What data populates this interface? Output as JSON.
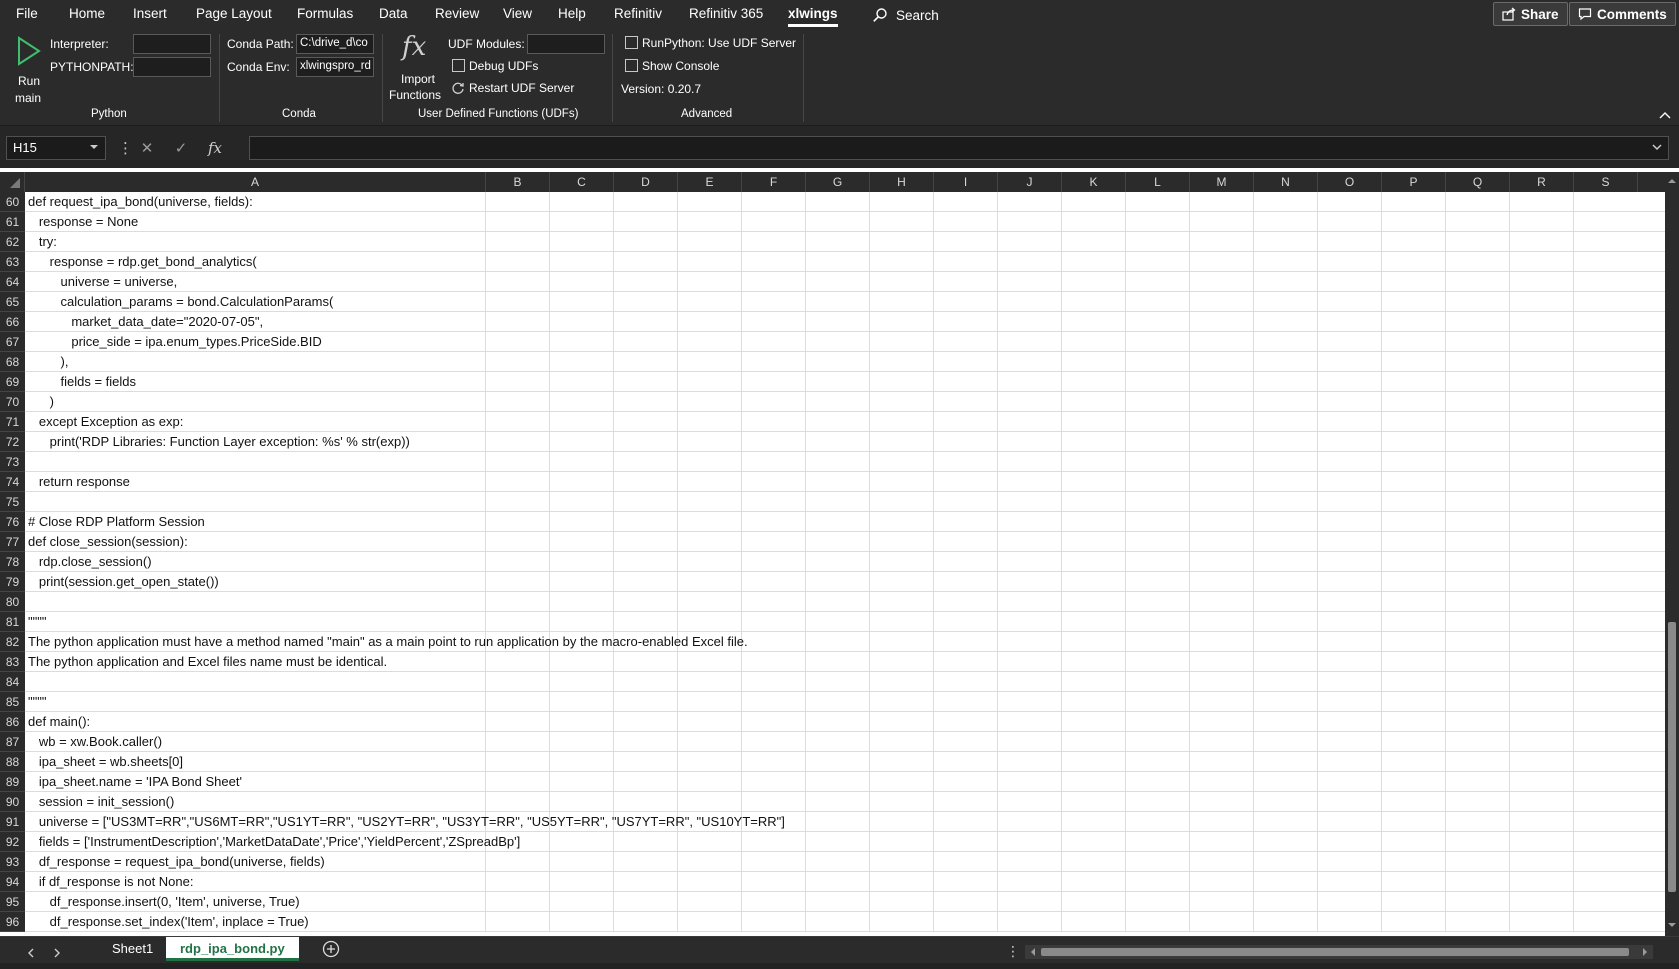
{
  "menu": {
    "tabs": [
      "File",
      "Home",
      "Insert",
      "Page Layout",
      "Formulas",
      "Data",
      "Review",
      "View",
      "Help",
      "Refinitiv",
      "Refinitiv 365",
      "xlwings"
    ],
    "active_tab": "xlwings",
    "search_label": "Search",
    "share_label": "Share",
    "comments_label": "Comments"
  },
  "ribbon": {
    "python": {
      "run_label_1": "Run",
      "run_label_2": "main",
      "interpreter_label": "Interpreter:",
      "interpreter_value": "",
      "pythonpath_label": "PYTHONPATH:",
      "pythonpath_value": "",
      "group_title": "Python"
    },
    "conda": {
      "path_label": "Conda Path:",
      "path_value": "C:\\drive_d\\co",
      "env_label": "Conda Env:",
      "env_value": "xlwingspro_rd",
      "group_title": "Conda"
    },
    "udf": {
      "fx_symbol": "fx",
      "import_label_1": "Import",
      "import_label_2": "Functions",
      "modules_label": "UDF Modules:",
      "modules_value": "",
      "debug_label": "Debug UDFs",
      "restart_label": "Restart UDF Server",
      "group_title": "User Defined Functions (UDFs)"
    },
    "advanced": {
      "runpython_label": "RunPython: Use UDF Server",
      "console_label": "Show Console",
      "version_label": "Version: 0.20.7",
      "group_title": "Advanced"
    }
  },
  "formula_bar": {
    "name_box": "H15",
    "fx_label": "fx",
    "cancel_glyph": "✕",
    "enter_glyph": "✓",
    "formula": ""
  },
  "columns": [
    "A",
    "B",
    "C",
    "D",
    "E",
    "F",
    "G",
    "H",
    "I",
    "J",
    "K",
    "L",
    "M",
    "N",
    "O",
    "P",
    "Q",
    "R",
    "S"
  ],
  "rows": [
    {
      "num": "60",
      "text": "def request_ipa_bond(universe, fields):"
    },
    {
      "num": "61",
      "text": "   response = None"
    },
    {
      "num": "62",
      "text": "   try:"
    },
    {
      "num": "63",
      "text": "      response = rdp.get_bond_analytics("
    },
    {
      "num": "64",
      "text": "         universe = universe,"
    },
    {
      "num": "65",
      "text": "         calculation_params = bond.CalculationParams("
    },
    {
      "num": "66",
      "text": "            market_data_date=\"2020-07-05\","
    },
    {
      "num": "67",
      "text": "            price_side = ipa.enum_types.PriceSide.BID"
    },
    {
      "num": "68",
      "text": "         ),"
    },
    {
      "num": "69",
      "text": "         fields = fields"
    },
    {
      "num": "70",
      "text": "      )"
    },
    {
      "num": "71",
      "text": "   except Exception as exp:"
    },
    {
      "num": "72",
      "text": "      print('RDP Libraries: Function Layer exception: %s' % str(exp))"
    },
    {
      "num": "73",
      "text": ""
    },
    {
      "num": "74",
      "text": "   return response"
    },
    {
      "num": "75",
      "text": ""
    },
    {
      "num": "76",
      "text": "# Close RDP Platform Session"
    },
    {
      "num": "77",
      "text": "def close_session(session):"
    },
    {
      "num": "78",
      "text": "   rdp.close_session()"
    },
    {
      "num": "79",
      "text": "   print(session.get_open_state())"
    },
    {
      "num": "80",
      "text": ""
    },
    {
      "num": "81",
      "text": "\"\"\"\""
    },
    {
      "num": "82",
      "text": "The python application must have a method named \"main\" as a main point to run application by the macro-enabled Excel file."
    },
    {
      "num": "83",
      "text": "The python application and Excel files name must be identical."
    },
    {
      "num": "84",
      "text": ""
    },
    {
      "num": "85",
      "text": "\"\"\"\""
    },
    {
      "num": "86",
      "text": "def main():"
    },
    {
      "num": "87",
      "text": "   wb = xw.Book.caller()"
    },
    {
      "num": "88",
      "text": "   ipa_sheet = wb.sheets[0]"
    },
    {
      "num": "89",
      "text": "   ipa_sheet.name = 'IPA Bond Sheet'"
    },
    {
      "num": "90",
      "text": "   session = init_session()"
    },
    {
      "num": "91",
      "text": "   universe = [\"US3MT=RR\",\"US6MT=RR\",\"US1YT=RR\", \"US2YT=RR\", \"US3YT=RR\", \"US5YT=RR\", \"US7YT=RR\", \"US10YT=RR\"]"
    },
    {
      "num": "92",
      "text": "   fields = ['InstrumentDescription','MarketDataDate','Price','YieldPercent','ZSpreadBp']"
    },
    {
      "num": "93",
      "text": "   df_response = request_ipa_bond(universe, fields)"
    },
    {
      "num": "94",
      "text": "   if df_response is not None:"
    },
    {
      "num": "95",
      "text": "      df_response.insert(0, 'Item', universe, True)"
    },
    {
      "num": "96",
      "text": "      df_response.set_index('Item', inplace = True)"
    }
  ],
  "sheets": [
    "Sheet1",
    "rdp_ipa_bond.py"
  ],
  "active_sheet": "rdp_ipa_bond.py",
  "colors": {
    "chrome": "#2b2b2b",
    "accent_green": "#217346",
    "run_icon": "#3fbf6f"
  },
  "icons": {
    "run": "play-triangle-icon",
    "search": "search-icon",
    "share": "share-icon",
    "comments": "comment-icon",
    "restart": "refresh-icon",
    "import": "fx-icon",
    "add_sheet": "plus-circle-icon"
  }
}
